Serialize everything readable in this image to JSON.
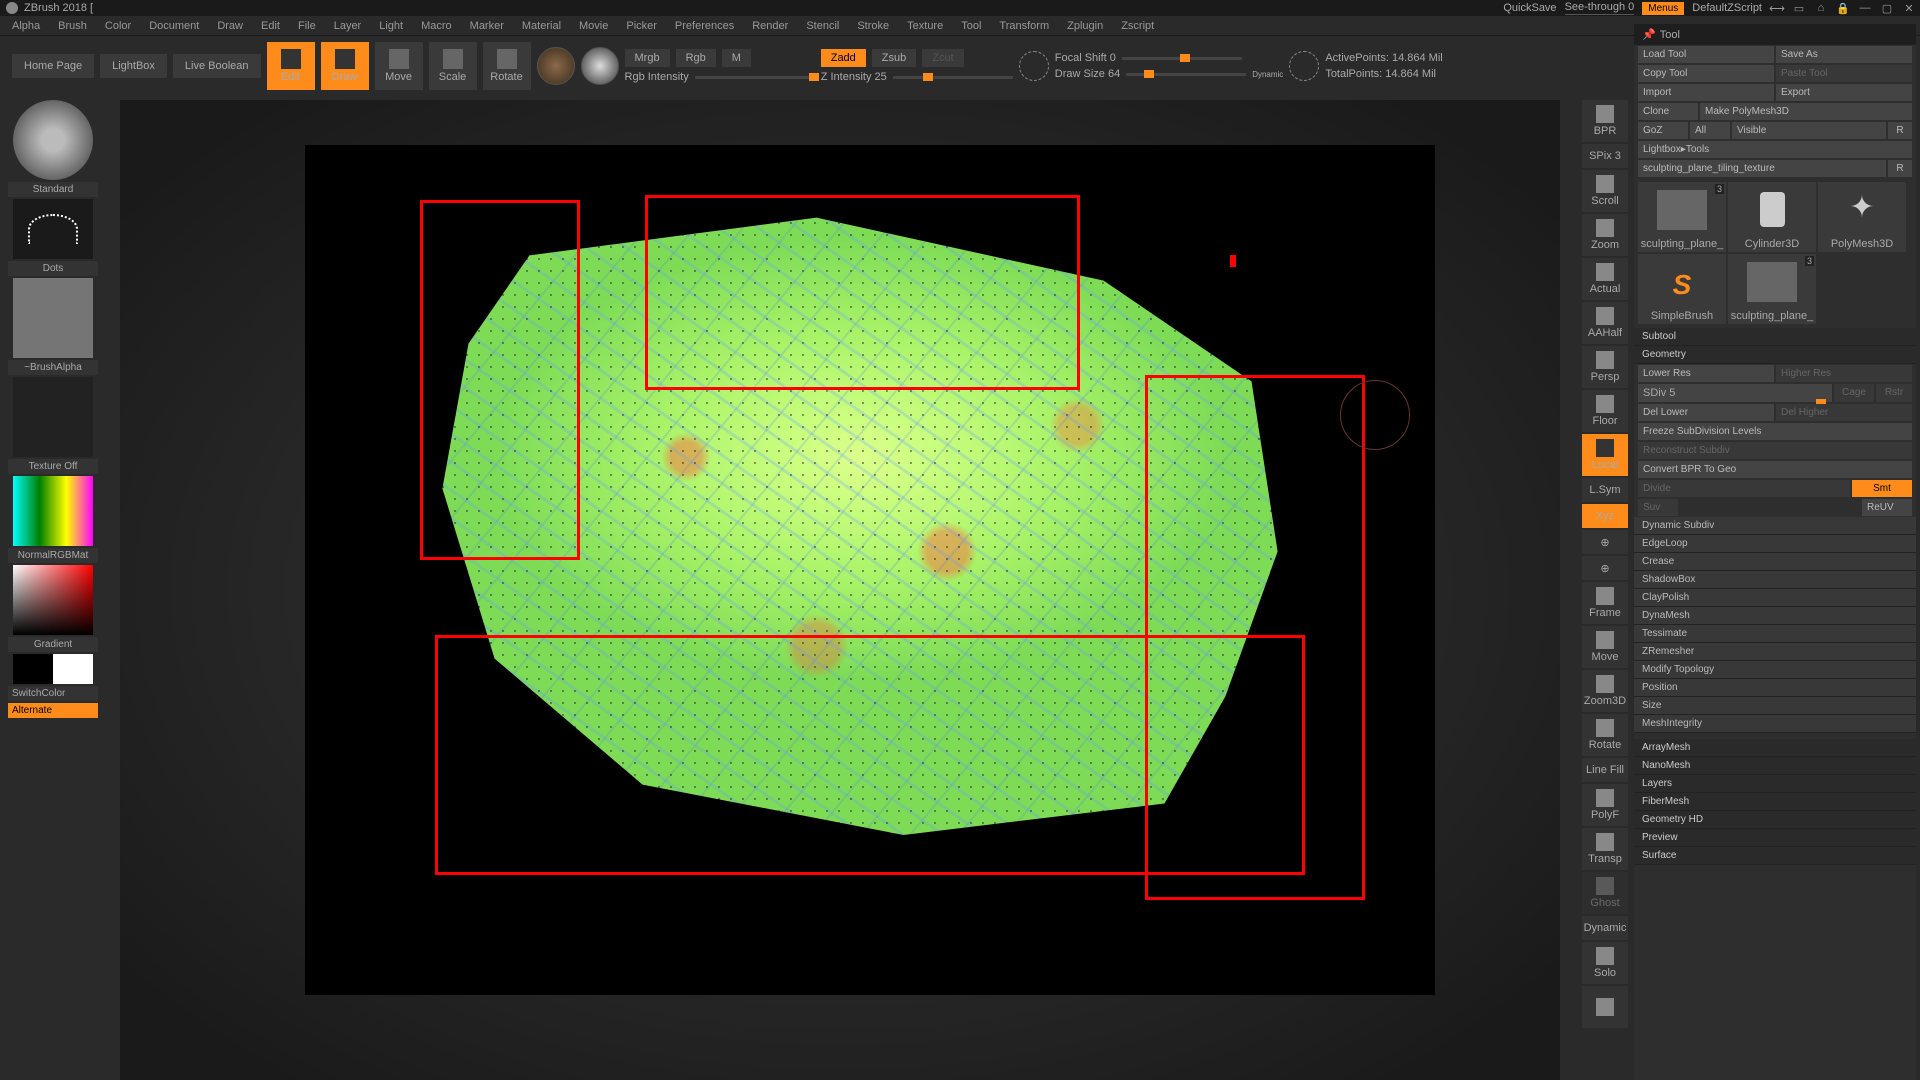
{
  "title": "ZBrush 2018 [",
  "titlebar": {
    "quicksave": "QuickSave",
    "seethrough": "See-through  0",
    "menus": "Menus",
    "script": "DefaultZScript"
  },
  "menu": [
    "Alpha",
    "Brush",
    "Color",
    "Document",
    "Draw",
    "Edit",
    "File",
    "Layer",
    "Light",
    "Macro",
    "Marker",
    "Material",
    "Movie",
    "Picker",
    "Preferences",
    "Render",
    "Stencil",
    "Stroke",
    "Texture",
    "Tool",
    "Transform",
    "Zplugin",
    "Zscript"
  ],
  "toolbar": {
    "home": "Home Page",
    "lightbox": "LightBox",
    "livebool": "Live Boolean",
    "edit": "Edit",
    "draw": "Draw",
    "move": "Move",
    "scale": "Scale",
    "rotate": "Rotate",
    "mrgb": "Mrgb",
    "rgb": "Rgb",
    "m": "M",
    "rgbint": "Rgb Intensity",
    "zadd": "Zadd",
    "zsub": "Zsub",
    "zcut": "Zcut",
    "zint": "Z Intensity 25",
    "focal": "Focal Shift 0",
    "drawsize": "Draw Size 64",
    "dynamic": "Dynamic",
    "active": "ActivePoints: 14.864 Mil",
    "total": "TotalPoints: 14.864 Mil"
  },
  "left": {
    "brush": "Standard",
    "stroke": "Dots",
    "alpha": "~BrushAlpha",
    "texture": "Texture Off",
    "mat": "NormalRGBMat",
    "gradient": "Gradient",
    "switch": "SwitchColor",
    "alternate": "Alternate"
  },
  "rstrip": {
    "bpr": "BPR",
    "spix": "SPix 3",
    "scroll": "Scroll",
    "zoom": "Zoom",
    "actual": "Actual",
    "aahalf": "AAHalf",
    "persp": "Persp",
    "floor": "Floor",
    "local": "Local",
    "lsym": "L.Sym",
    "xyz": "Xyz",
    "frame": "Frame",
    "move": "Move",
    "zoom3d": "Zoom3D",
    "rotate": "Rotate",
    "linefill": "Line Fill",
    "polyf": "PolyF",
    "transp": "Transp",
    "ghost": "Ghost",
    "dyn": "Dynamic",
    "solo": "Solo"
  },
  "tool": {
    "header": "Tool",
    "load": "Load Tool",
    "saveas": "Save As",
    "copy": "Copy Tool",
    "paste": "Paste Tool",
    "import": "Import",
    "export": "Export",
    "clone": "Clone",
    "polymesh": "Make PolyMesh3D",
    "goz": "GoZ",
    "all": "All",
    "visible": "Visible",
    "r": "R",
    "lightbox": "Lightbox▸Tools",
    "toolname": "sculpting_plane_tiling_texture",
    "thumbs": [
      "sculpting_plane_",
      "Cylinder3D",
      "PolyMesh3D",
      "SimpleBrush",
      "sculpting_plane_"
    ],
    "subtool": "Subtool",
    "geometry": "Geometry",
    "lower": "Lower Res",
    "higher": "Higher Res",
    "sdiv": "SDiv 5",
    "cage": "Cage",
    "rstr": "Rstr",
    "dellower": "Del Lower",
    "delhigher": "Del Higher",
    "freeze": "Freeze SubDivision Levels",
    "reconstruct": "Reconstruct Subdiv",
    "convert": "Convert BPR To Geo",
    "divide": "Divide",
    "smt": "Smt",
    "suv": "Suv",
    "reuv": "ReUV",
    "sections": [
      "Dynamic Subdiv",
      "EdgeLoop",
      "Crease",
      "ShadowBox",
      "ClayPolish",
      "DynaMesh",
      "Tessimate",
      "ZRemesher",
      "Modify Topology",
      "Position",
      "Size",
      "MeshIntegrity",
      "ArrayMesh",
      "NanoMesh",
      "Layers",
      "FiberMesh",
      "Geometry HD",
      "Preview",
      "Surface"
    ]
  }
}
